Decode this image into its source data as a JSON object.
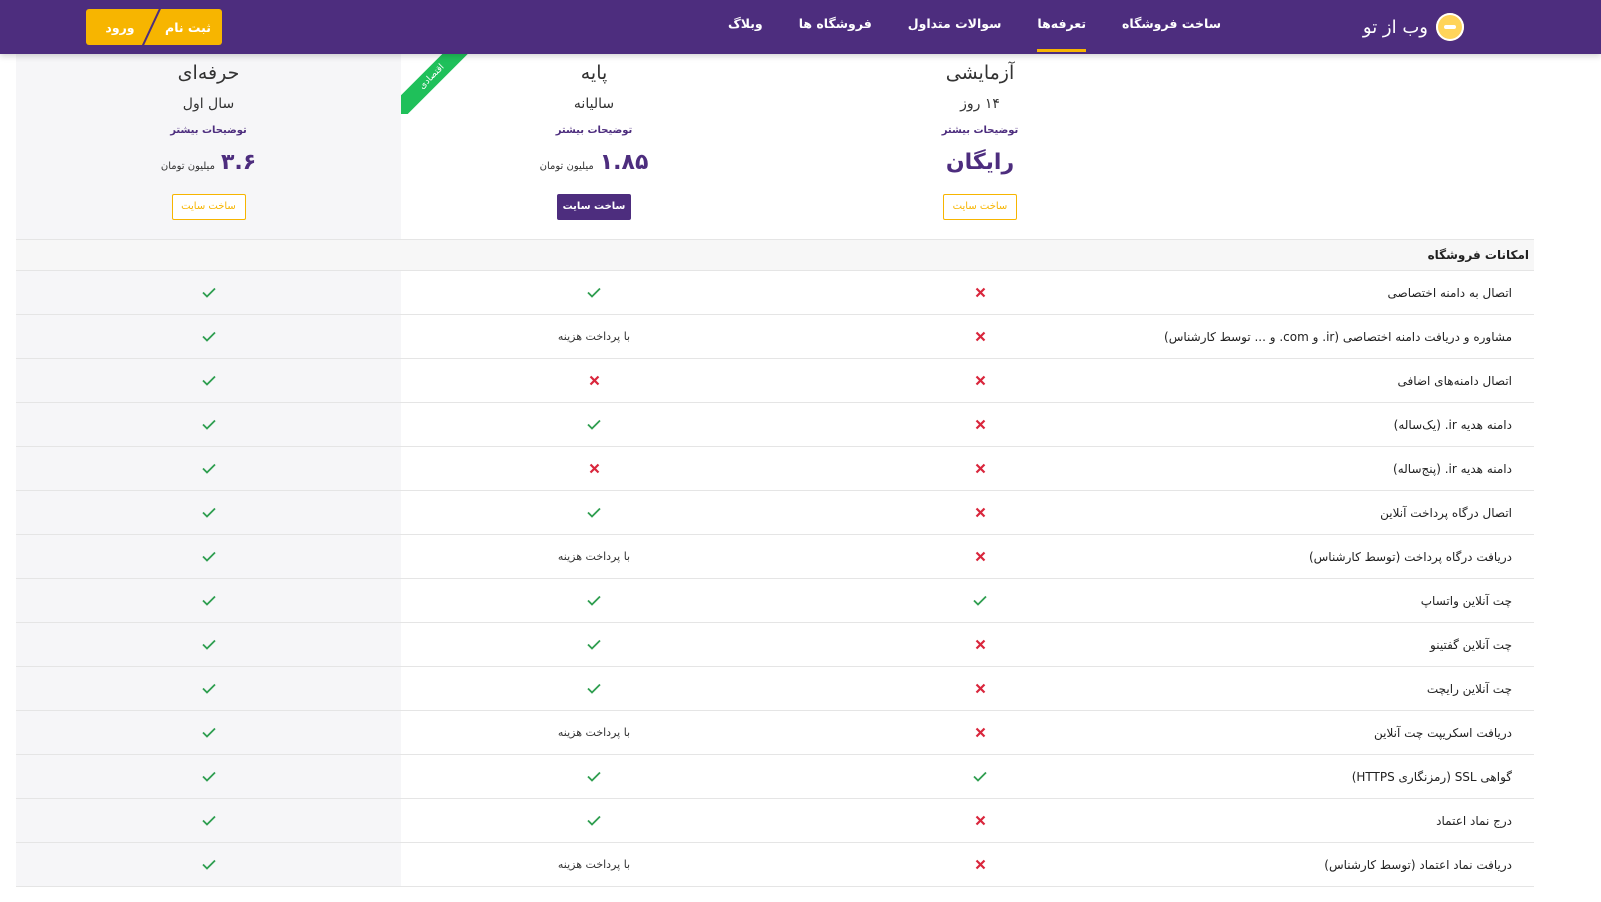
{
  "header": {
    "brand_name": "وب از تو",
    "nav": [
      {
        "label": "ساخت فروشگاه",
        "active": false
      },
      {
        "label": "تعرفه‌ها",
        "active": true
      },
      {
        "label": "سوالات متداول",
        "active": false
      },
      {
        "label": "فروشگاه ها",
        "active": false
      },
      {
        "label": "وبلاگ",
        "active": false
      }
    ],
    "signup_label": "ثبت نام",
    "login_label": "ورود"
  },
  "plans": [
    {
      "key": "trial",
      "name": "آزمایشی",
      "period": "۱۴ روز",
      "more": "توضیحات بیشتر",
      "price_text": "رایگان",
      "button": "ساخت سایت"
    },
    {
      "key": "basic",
      "name": "پایه",
      "period": "سالیانه",
      "more": "توضیحات بیشتر",
      "price_value": "۱.۸۵",
      "price_unit": "میلیون تومان",
      "button": "ساخت سایت",
      "ribbon": "اقتصادی"
    },
    {
      "key": "pro",
      "name": "حرفه‌ای",
      "period": "سال اول",
      "more": "توضیحات بیشتر",
      "price_value": "۳.۶",
      "price_unit": "میلیون تومان",
      "button": "ساخت سایت"
    }
  ],
  "section_title": "امکانات فروشگاه",
  "paid_text": "با پرداخت هزینه",
  "colors": {
    "primary": "#4d2d7e",
    "accent": "#f7b500",
    "check": "#2e9e4f",
    "cross": "#d9263c",
    "ribbon": "#1fc05a"
  },
  "rows": [
    {
      "label": "اتصال به دامنه اختصاصی",
      "trial": "no",
      "basic": "yes",
      "pro": "yes"
    },
    {
      "label": "مشاوره و دریافت دامنه اختصاصی (ir. و com. و ... توسط کارشناس)",
      "trial": "no",
      "basic": "paid",
      "pro": "yes"
    },
    {
      "label": "اتصال دامنه‌های اضافی",
      "trial": "no",
      "basic": "no",
      "pro": "yes"
    },
    {
      "label": "دامنه هدیه ir. (یک‌ساله)",
      "trial": "no",
      "basic": "yes",
      "pro": "yes"
    },
    {
      "label": "دامنه هدیه ir. (پنج‌ساله)",
      "trial": "no",
      "basic": "no",
      "pro": "yes"
    },
    {
      "label": "اتصال درگاه پرداخت آنلاین",
      "trial": "no",
      "basic": "yes",
      "pro": "yes"
    },
    {
      "label": "دریافت درگاه پرداخت (توسط کارشناس)",
      "trial": "no",
      "basic": "paid",
      "pro": "yes"
    },
    {
      "label": "چت آنلاین واتساپ",
      "trial": "yes",
      "basic": "yes",
      "pro": "yes"
    },
    {
      "label": "چت آنلاین گفتینو",
      "trial": "no",
      "basic": "yes",
      "pro": "yes"
    },
    {
      "label": "چت آنلاین رایچت",
      "trial": "no",
      "basic": "yes",
      "pro": "yes"
    },
    {
      "label": "دریافت اسکریپت چت آنلاین",
      "trial": "no",
      "basic": "paid",
      "pro": "yes"
    },
    {
      "label": "گواهی SSL (رمزنگاری HTTPS)",
      "trial": "yes",
      "basic": "yes",
      "pro": "yes"
    },
    {
      "label": "درج نماد اعتماد",
      "trial": "no",
      "basic": "yes",
      "pro": "yes"
    },
    {
      "label": "دریافت نماد اعتماد (توسط کارشناس)",
      "trial": "no",
      "basic": "paid",
      "pro": "yes"
    }
  ]
}
